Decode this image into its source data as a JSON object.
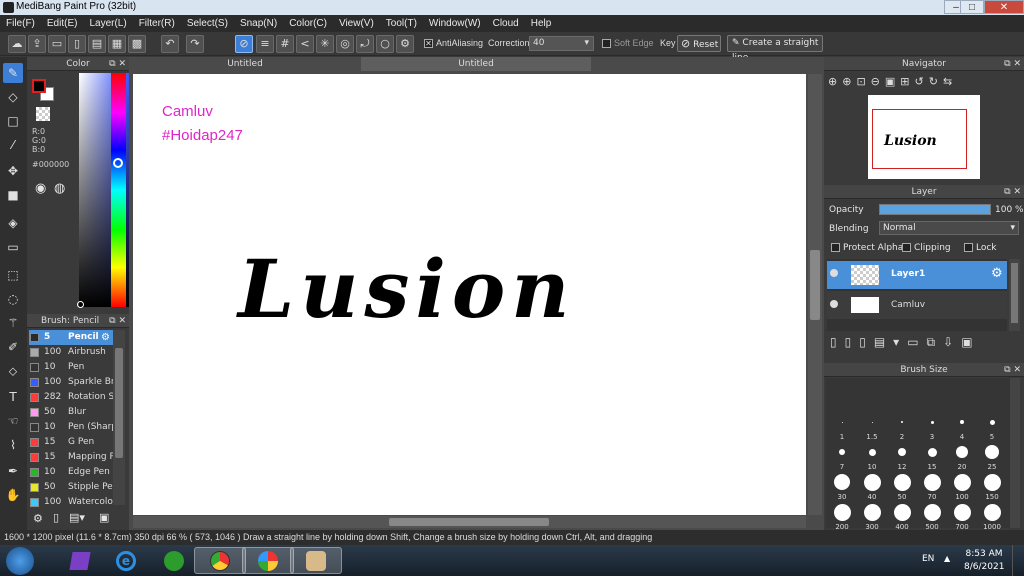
{
  "window": {
    "title": "MediBang Paint Pro (32bit)",
    "minimize": "–",
    "maximize": "□",
    "close": "✕"
  },
  "menu": [
    "File(F)",
    "Edit(E)",
    "Layer(L)",
    "Filter(R)",
    "Select(S)",
    "Snap(N)",
    "Color(C)",
    "View(V)",
    "Tool(T)",
    "Window(W)",
    "Cloud",
    "Help"
  ],
  "toolbar": {
    "antialiasing": "AntiAliasing",
    "correction_label": "Correction",
    "correction_value": "40",
    "soft_edge": "Soft Edge",
    "key_label": "Key",
    "reset": "Reset",
    "straight_line": "Create a straight line"
  },
  "color_panel": {
    "title": "Color",
    "r": "R:0",
    "g": "G:0",
    "b": "B:0",
    "hex": "#000000",
    "fg": "#000000",
    "bg": "#ffffff"
  },
  "brush_panel": {
    "title": "Brush: Pencil",
    "brushes": [
      {
        "size": "5",
        "name": "Pencil",
        "color": "#2a2a2a"
      },
      {
        "size": "100",
        "name": "Airbrush",
        "color": "#aaaaaa"
      },
      {
        "size": "10",
        "name": "Pen",
        "color": "#333333"
      },
      {
        "size": "100",
        "name": "Sparkle Br",
        "color": "#3a5cff"
      },
      {
        "size": "282",
        "name": "Rotation S",
        "color": "#ff3a3a"
      },
      {
        "size": "50",
        "name": "Blur",
        "color": "#ff99ee"
      },
      {
        "size": "10",
        "name": "Pen (Sharp",
        "color": "#333333"
      },
      {
        "size": "15",
        "name": "G Pen",
        "color": "#ff3a3a"
      },
      {
        "size": "15",
        "name": "Mapping P",
        "color": "#ff3a3a"
      },
      {
        "size": "10",
        "name": "Edge Pen",
        "color": "#2bb52b"
      },
      {
        "size": "50",
        "name": "Stipple Pe",
        "color": "#e8e82a"
      },
      {
        "size": "100",
        "name": "Watercolo",
        "color": "#3ac8ff"
      }
    ]
  },
  "tabs": [
    "Untitled",
    "Untitled"
  ],
  "canvas": {
    "line1": "Camluv",
    "line2": "#Hoidap247",
    "script_text": "Lusion"
  },
  "navigator": {
    "title": "Navigator"
  },
  "layer_panel": {
    "title": "Layer",
    "opacity_label": "Opacity",
    "opacity_value": "100 %",
    "blending_label": "Blending",
    "blending_value": "Normal",
    "protect_alpha": "Protect Alpha",
    "clipping": "Clipping",
    "lock": "Lock",
    "layers": [
      {
        "name": "Layer1",
        "selected": true
      },
      {
        "name": "Camluv",
        "selected": false
      }
    ]
  },
  "brush_size_panel": {
    "title": "Brush Size",
    "sizes": [
      "",
      "",
      "",
      "",
      "",
      "",
      "1",
      "1.5",
      "2",
      "3",
      "4",
      "5",
      "7",
      "10",
      "12",
      "15",
      "20",
      "25",
      "30",
      "40",
      "50",
      "70",
      "100",
      "150",
      "200",
      "300",
      "400",
      "500",
      "700",
      "1000"
    ]
  },
  "status": {
    "text": "1600 * 1200 pixel   (11.6 * 8.7cm)   350 dpi   66 %   ( 573, 1046 )   Draw a straight line by holding down Shift, Change a brush size by holding down Ctrl, Alt, and dragging"
  },
  "taskbar": {
    "lang": "EN",
    "time": "8:53 AM",
    "date": "8/6/2021"
  }
}
